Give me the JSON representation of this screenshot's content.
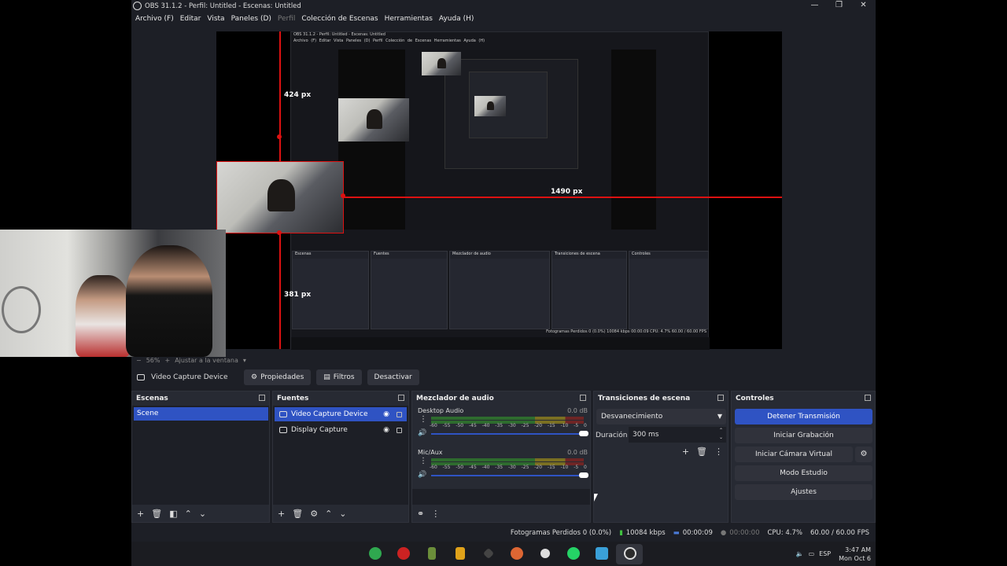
{
  "window": {
    "title": "OBS 31.1.2 - Perfil: Untitled - Escenas: Untitled",
    "controls": [
      "—",
      "❐",
      "✕"
    ]
  },
  "menu": [
    "Archivo (F)",
    "Editar",
    "Vista",
    "Paneles (D)",
    "Perfil",
    "Colección de Escenas",
    "Herramientas",
    "Ayuda (H)"
  ],
  "preview": {
    "measure_top": "424 px",
    "measure_left": "381 px",
    "measure_right": "1490 px",
    "nested_title": "OBS 31.1.2 - Perfil: Untitled - Escenas: Untitled",
    "nested_menu": "Archivo (F)  Editar  Vista  Paneles (D)  Perfil  Colección de Escenas  Herramientas  Ayuda (H)",
    "nested_status": "Fotogramas Perdidos 0 (0.0%)   10084 kbps   00:00:09   CPU: 4.7%   60.00 / 60.00 FPS"
  },
  "zoom": {
    "minus": "−",
    "value": "56%",
    "plus": "+",
    "fit": "Ajustar a la ventana",
    "arrow": "▾"
  },
  "source_toolbar": {
    "source_name": "Video Capture Device",
    "properties": "Propiedades",
    "filters": "Filtros",
    "deactivate": "Desactivar"
  },
  "scenes": {
    "title": "Escenas",
    "items": [
      "Scene"
    ]
  },
  "sources": {
    "title": "Fuentes",
    "items": [
      "Video Capture Device",
      "Display Capture"
    ]
  },
  "mixer": {
    "title": "Mezclador de audio",
    "channels": [
      {
        "name": "Desktop Audio",
        "db": "0.0 dB"
      },
      {
        "name": "Mic/Aux",
        "db": "0.0 dB"
      }
    ],
    "ticks": [
      "-60",
      "-55",
      "-50",
      "-45",
      "-40",
      "-35",
      "-30",
      "-25",
      "-20",
      "-15",
      "-10",
      "-5",
      "0"
    ]
  },
  "transitions": {
    "title": "Transiciones de escena",
    "selected": "Desvanecimiento",
    "duration_label": "Duración",
    "duration_value": "300 ms"
  },
  "controls": {
    "title": "Controles",
    "stop_stream": "Detener Transmisión",
    "start_record": "Iniciar Grabación",
    "virtual_cam": "Iniciar Cámara Virtual",
    "studio_mode": "Modo Estudio",
    "settings": "Ajustes"
  },
  "status": {
    "dropped": "Fotogramas Perdidos 0 (0.0%)",
    "kbps": "10084 kbps",
    "stream_time": "00:00:09",
    "rec_time": "00:00:00",
    "cpu": "CPU: 4.7%",
    "fps": "60.00 / 60.00 FPS"
  },
  "taskbar": {
    "lang": "ESP",
    "time": "3:47 AM",
    "date": "Mon Oct 6"
  },
  "colors": {
    "accent": "#2f53c3",
    "bg": "#1d1f26",
    "dock": "#272a33",
    "selection": "#dd1111"
  }
}
